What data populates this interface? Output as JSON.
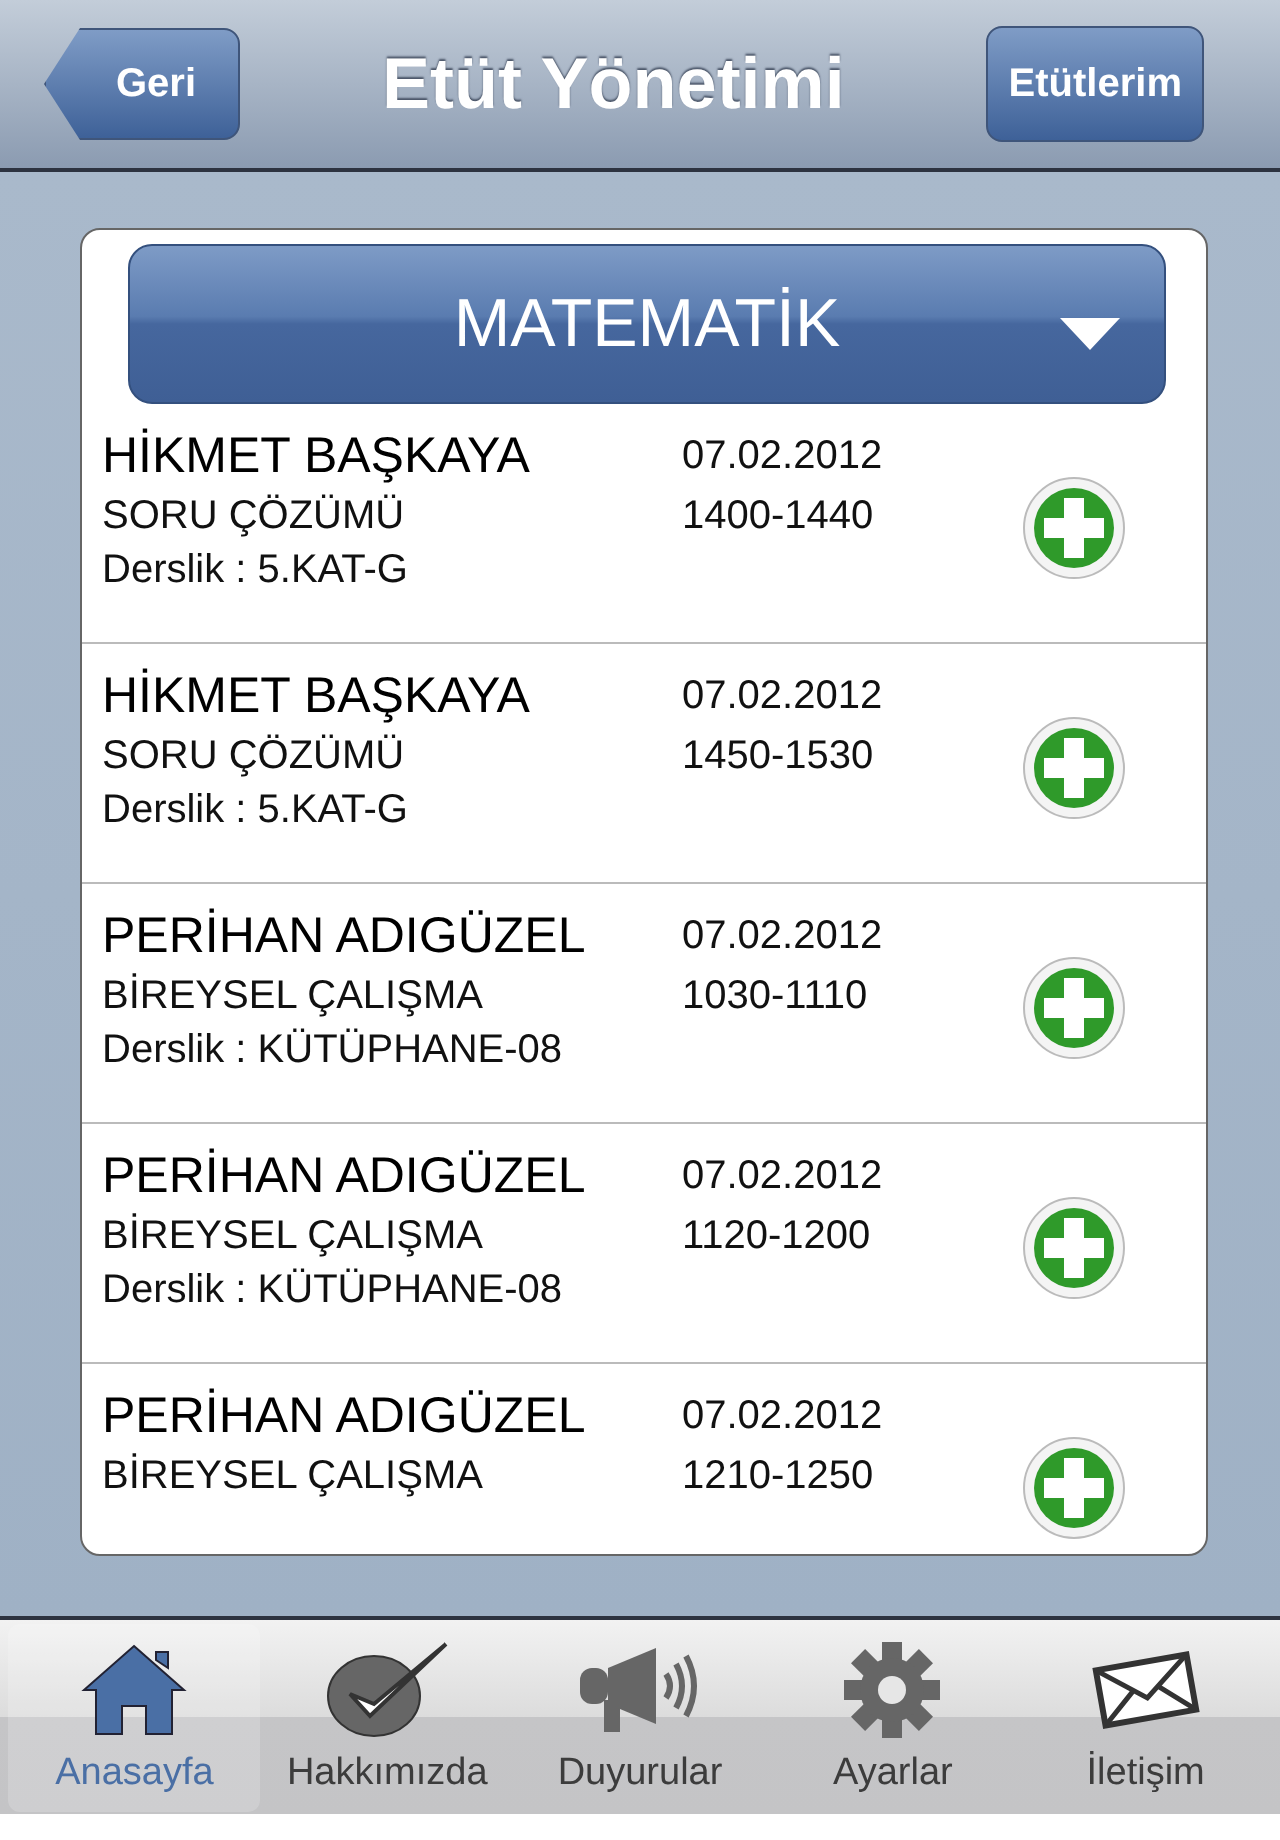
{
  "nav_bar": {
    "back_button": "Geri",
    "title": "Etüt Yönetimi",
    "right_button": "Etütlerim"
  },
  "subject_picker": {
    "value": "MATEMATİK"
  },
  "sessions": [
    {
      "teacher": "HİKMET BAŞKAYA",
      "date": "07.02.2012",
      "type": "SORU ÇÖZÜMÜ",
      "time": "1400-1440",
      "room": "Derslik : 5.KAT-G"
    },
    {
      "teacher": "HİKMET BAŞKAYA",
      "date": "07.02.2012",
      "type": "SORU ÇÖZÜMÜ",
      "time": "1450-1530",
      "room": "Derslik : 5.KAT-G"
    },
    {
      "teacher": "PERİHAN ADIGÜZEL",
      "date": "07.02.2012",
      "type": "BİREYSEL ÇALIŞMA",
      "time": "1030-1110",
      "room": "Derslik : KÜTÜPHANE-08"
    },
    {
      "teacher": "PERİHAN ADIGÜZEL",
      "date": "07.02.2012",
      "type": "BİREYSEL ÇALIŞMA",
      "time": "1120-1200",
      "room": "Derslik : KÜTÜPHANE-08"
    },
    {
      "teacher": "PERİHAN ADIGÜZEL",
      "date": "07.02.2012",
      "type": "BİREYSEL ÇALIŞMA",
      "time": "1210-1250"
    }
  ],
  "tab_bar": [
    {
      "label": "Anasayfa",
      "kind": "home",
      "selected": true
    },
    {
      "label": "Hakkımızda",
      "kind": "check",
      "selected": false
    },
    {
      "label": "Duyurular",
      "kind": "megaphone",
      "selected": false
    },
    {
      "label": "Ayarlar",
      "kind": "gear",
      "selected": false
    },
    {
      "label": "İletişim",
      "kind": "mail",
      "selected": false
    }
  ]
}
